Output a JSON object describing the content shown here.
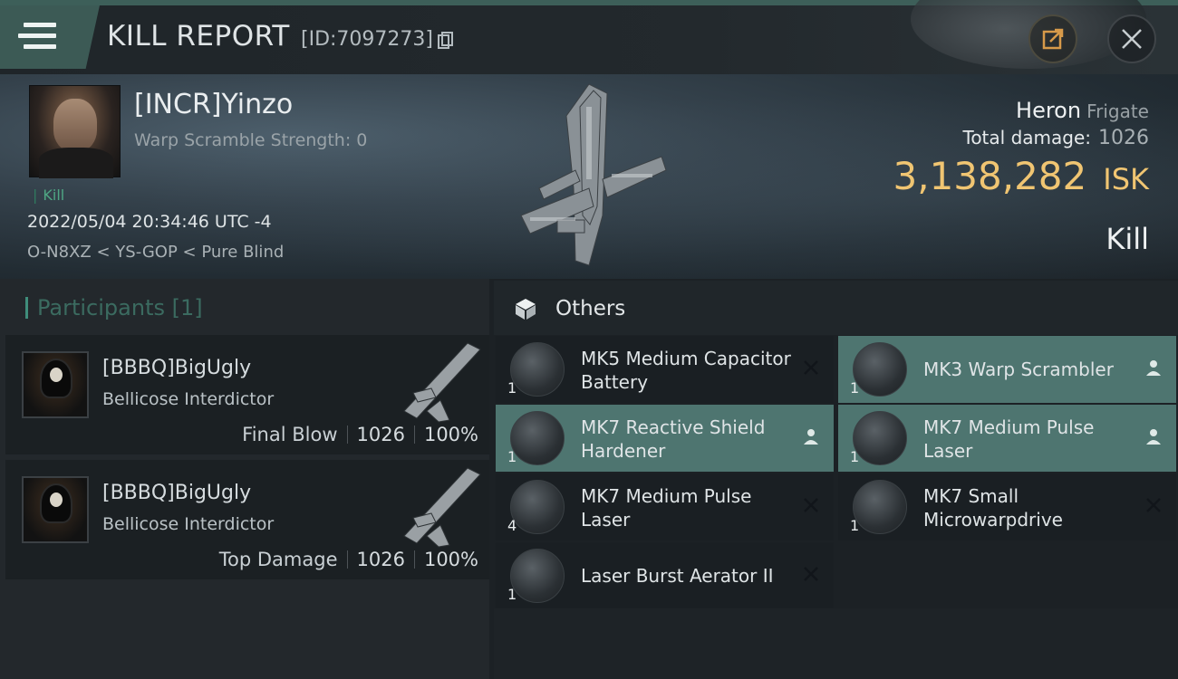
{
  "header": {
    "title": "KILL REPORT",
    "report_id": "[ID:7097273]"
  },
  "victim": {
    "name": "[INCR]Yinzo",
    "warp_scramble": "Warp Scramble Strength: 0",
    "kill_tag": "Kill",
    "datetime": "2022/05/04 20:34:46 UTC -4",
    "location": "O-N8XZ < YS-GOP < Pure Blind",
    "ship_name": "Heron",
    "ship_class": "Frigate",
    "total_damage_label": "Total damage:",
    "total_damage_value": "1026",
    "isk_value": "3,138,282",
    "isk_unit": "ISK",
    "result": "Kill"
  },
  "participants": {
    "header": "Participants [1]",
    "rows": [
      {
        "name": "[BBBQ]BigUgly",
        "ship": "Bellicose Interdictor",
        "label": "Final Blow",
        "damage": "1026",
        "percent": "100%"
      },
      {
        "name": "[BBBQ]BigUgly",
        "ship": "Bellicose Interdictor",
        "label": "Top Damage",
        "damage": "1026",
        "percent": "100%"
      }
    ]
  },
  "others": {
    "header": "Others",
    "items": [
      {
        "name": "MK5 Medium Capacitor Battery",
        "qty": "1",
        "action": "close-icon",
        "highlight": false
      },
      {
        "name": "MK3 Warp Scrambler",
        "qty": "1",
        "action": "person-icon",
        "highlight": true
      },
      {
        "name": "MK7 Reactive Shield Hardener",
        "qty": "1",
        "action": "person-icon",
        "highlight": true
      },
      {
        "name": "MK7 Medium Pulse Laser",
        "qty": "1",
        "action": "person-icon",
        "highlight": true
      },
      {
        "name": "MK7 Medium Pulse Laser",
        "qty": "4",
        "action": "close-icon",
        "highlight": false
      },
      {
        "name": "MK7 Small Microwarpdrive",
        "qty": "1",
        "action": "close-icon",
        "highlight": false
      },
      {
        "name": "Laser Burst Aerator II",
        "qty": "1",
        "action": "close-icon",
        "highlight": false
      }
    ]
  },
  "colors": {
    "accent_teal": "#4e7570",
    "isk_gold": "#f0c572",
    "kill_green": "#4fa784"
  }
}
